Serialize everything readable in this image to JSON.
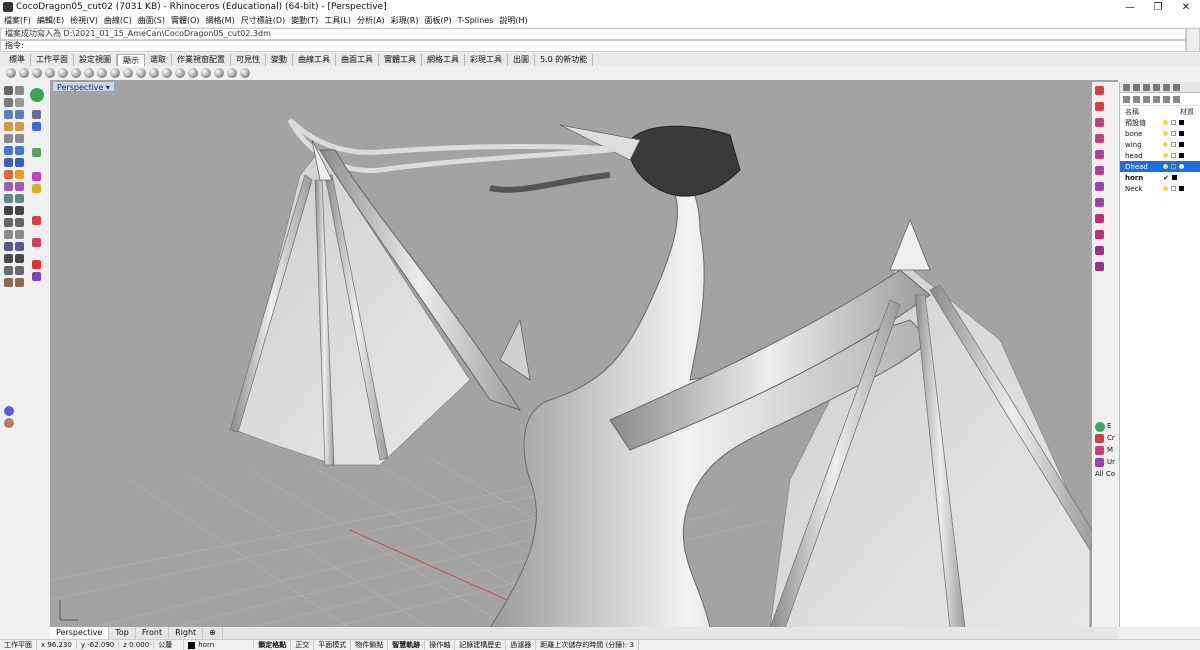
{
  "window": {
    "title": "CocoDragon05_cut02 (7031 KB) - Rhinoceros (Educational) (64-bit) - [Perspective]",
    "controls": [
      "—",
      "❐",
      "✕"
    ]
  },
  "menu": [
    "檔案(F)",
    "編輯(E)",
    "檢視(V)",
    "曲線(C)",
    "曲面(S)",
    "實體(O)",
    "網格(M)",
    "尺寸標註(D)",
    "變動(T)",
    "工具(L)",
    "分析(A)",
    "彩現(R)",
    "面板(P)",
    "T-Splines",
    "說明(H)"
  ],
  "command": {
    "history": "檔案成功寫入為 D:\\2021_01_15_AmeCan\\CocoDragon05_cut02.3dm",
    "prompt": "指令:"
  },
  "toolbar_tabs": [
    "標準",
    "工作平面",
    "設定視圖",
    "顯示",
    "選取",
    "作業視窗配置",
    "可見性",
    "變動",
    "曲線工具",
    "曲面工具",
    "實體工具",
    "網格工具",
    "彩現工具",
    "出圖",
    "5.0 的新功能"
  ],
  "active_toolbar_tab": "顯示",
  "viewport": {
    "label": "Perspective",
    "label_suffix": "▾"
  },
  "layers_panel": {
    "col_name": "名稱",
    "col_material": "材質",
    "layers": [
      {
        "name": "預設值",
        "selected": false
      },
      {
        "name": "bone",
        "selected": false
      },
      {
        "name": "wing",
        "selected": false
      },
      {
        "name": "head",
        "selected": false
      },
      {
        "name": "Dhead",
        "selected": true
      },
      {
        "name": "horn",
        "selected": false
      },
      {
        "name": "Neck",
        "selected": false
      }
    ]
  },
  "right_strip_labels": [
    "E",
    "Cr",
    "M",
    "Ur",
    "All Co"
  ],
  "view_tabs": [
    "Perspective",
    "Top",
    "Front",
    "Right",
    "⊕"
  ],
  "active_view_tab": "Perspective",
  "status": {
    "cplane": "工作平面",
    "x": "x 96.230",
    "y": "y -62.090",
    "z": "z 0.000",
    "units": "公釐",
    "layer": "horn",
    "toggles": [
      "鎖定格點",
      "正交",
      "平面模式",
      "物件鎖點",
      "智慧軌跡",
      "操作軸",
      "記錄建構歷史",
      "過濾器"
    ],
    "bold_toggles": [
      "鎖定格點",
      "智慧軌跡"
    ],
    "save_info": "距離上次儲存的時間 (分鐘): 3"
  }
}
